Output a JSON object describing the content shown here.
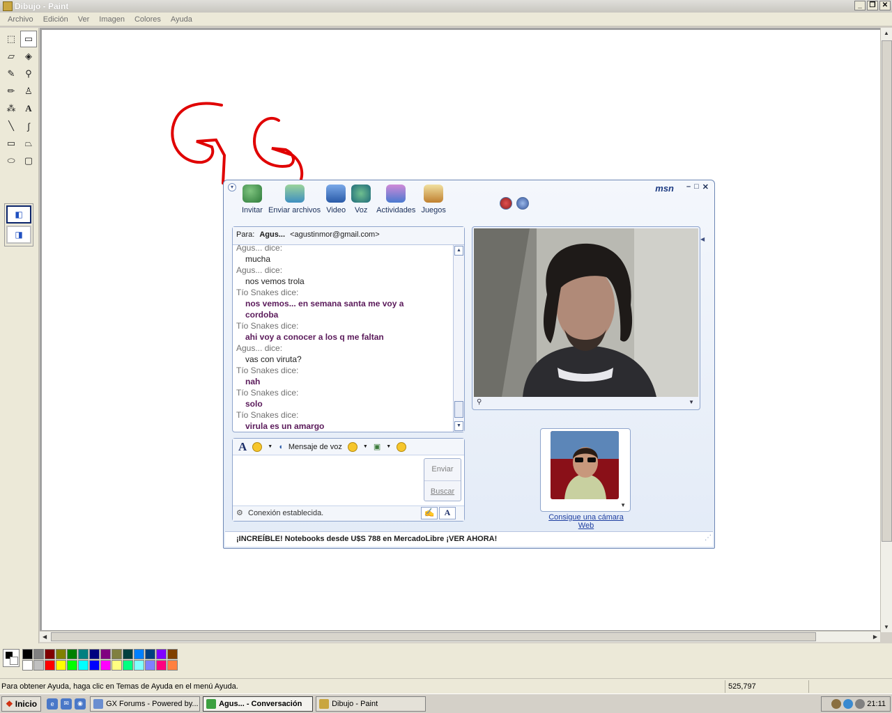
{
  "window": {
    "title": "Dibujo - Paint"
  },
  "menu": [
    "Archivo",
    "Edición",
    "Ver",
    "Imagen",
    "Colores",
    "Ayuda"
  ],
  "palette": {
    "row1": [
      "#000000",
      "#808080",
      "#800000",
      "#808000",
      "#008000",
      "#008080",
      "#000080",
      "#800080",
      "#808040",
      "#004040",
      "#0080ff",
      "#004080",
      "#8000ff",
      "#804000"
    ],
    "row2": [
      "#ffffff",
      "#c0c0c0",
      "#ff0000",
      "#ffff00",
      "#00ff00",
      "#00ffff",
      "#0000ff",
      "#ff00ff",
      "#ffff80",
      "#00ff80",
      "#80ffff",
      "#8080ff",
      "#ff0080",
      "#ff8040"
    ]
  },
  "status": {
    "help": "Para obtener Ayuda, haga clic en Temas de Ayuda en el menú Ayuda.",
    "coords": "525,797"
  },
  "taskbar": {
    "start": "Inicio",
    "tasks": [
      "GX Forums - Powered by...",
      "Agus... - Conversación",
      "Dibujo - Paint"
    ],
    "clock": "21:11"
  },
  "msn": {
    "logo": "msn",
    "tools": [
      "Invitar",
      "Enviar archivos",
      "Video",
      "Voz",
      "Actividades",
      "Juegos"
    ],
    "to_label": "Para:",
    "to_name": "Agus...",
    "to_email": "<agustinmor@gmail.com>",
    "messages": [
      {
        "who": "Agus... dice:",
        "text": "mucha",
        "me": false
      },
      {
        "who": "Agus... dice:",
        "text": "nos vemos trola",
        "me": false
      },
      {
        "who": "Tío Snakes dice:",
        "text": "nos vemos... en semana santa me voy a",
        "me": true
      },
      {
        "who": "",
        "text": "cordoba",
        "me": true
      },
      {
        "who": "Tío Snakes dice:",
        "text": "ahi voy a conocer a los q me faltan",
        "me": true
      },
      {
        "who": "Agus... dice:",
        "text": "vas con viruta?",
        "me": false
      },
      {
        "who": "Tío Snakes dice:",
        "text": "nah",
        "me": true
      },
      {
        "who": "Tío Snakes dice:",
        "text": "solo",
        "me": true
      },
      {
        "who": "Tío Snakes dice:",
        "text": "virula es un amargo",
        "me": true
      }
    ],
    "compose": {
      "voice_label": "Mensaje de voz",
      "send": "Enviar",
      "search": "Buscar"
    },
    "connection": "Conexión establecida.",
    "cam_link": "Consigue una cámara Web",
    "ad": "¡INCREÍBLE! Notebooks desde U$S 788 en MercadoLibre ¡VER AHORA!"
  },
  "colors": {
    "accent": "#1d3b82",
    "scribble": "#e00000"
  }
}
